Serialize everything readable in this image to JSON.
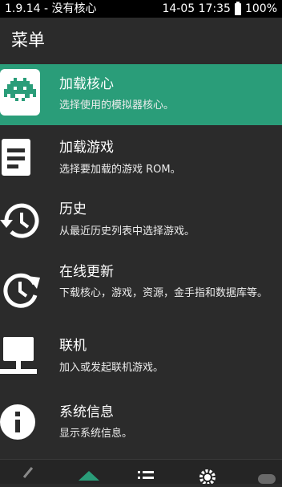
{
  "status_bar": {
    "left_text": "1.9.14 - 没有核心",
    "right_text": "14-05 17:35",
    "battery_text": "100%"
  },
  "app_bar": {
    "title": "菜单"
  },
  "menu": {
    "items": [
      {
        "title": "加载核心",
        "subtitle": "选择使用的模拟器核心。",
        "icon": "space-invader-icon",
        "active": true
      },
      {
        "title": "加载游戏",
        "subtitle": "选择要加载的游戏 ROM。",
        "icon": "file-icon",
        "active": false
      },
      {
        "title": "历史",
        "subtitle": "从最近历史列表中选择游戏。",
        "icon": "history-icon",
        "active": false
      },
      {
        "title": "在线更新",
        "subtitle": "下载核心，游戏，资源，金手指和数据库等。",
        "icon": "update-icon",
        "active": false
      },
      {
        "title": "联机",
        "subtitle": "加入或发起联机游戏。",
        "icon": "network-icon",
        "active": false
      },
      {
        "title": "系统信息",
        "subtitle": "显示系统信息。",
        "icon": "info-icon",
        "active": false
      }
    ]
  },
  "bottom_tabs": [
    {
      "icon": "back-icon"
    },
    {
      "icon": "home-icon",
      "selected": true
    },
    {
      "icon": "list-icon"
    },
    {
      "icon": "settings-icon"
    },
    {
      "icon": "gamepad-icon"
    }
  ],
  "colors": {
    "accent": "#2a9d79",
    "background": "#2b2b2b",
    "status_bar": "#000000"
  }
}
